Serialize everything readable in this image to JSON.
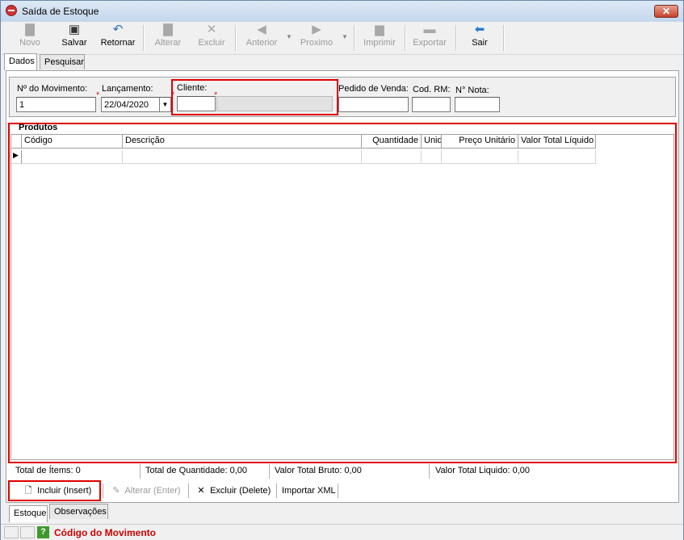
{
  "window": {
    "title": "Saída de Estoque"
  },
  "toolbar": {
    "novo": "Novo",
    "salvar": "Salvar",
    "retornar": "Retornar",
    "alterar": "Alterar",
    "excluir": "Excluir",
    "anterior": "Anterior",
    "proximo": "Proximo",
    "imprimir": "Imprimir",
    "exportar": "Exportar",
    "sair": "Sair"
  },
  "tabs_top": [
    "Dados",
    "Pesquisar"
  ],
  "header": {
    "movimento_label": "Nº do Movimento:",
    "movimento_value": "1",
    "lancamento_label": "Lançamento:",
    "lancamento_value": "22/04/2020",
    "cliente_label": "Cliente:",
    "cliente_code": "",
    "cliente_name": "",
    "pedido_label": "Pedido de Venda:",
    "pedido_value": "",
    "codrm_label": "Cod. RM:",
    "codrm_value": "",
    "nota_label": "N° Nota:",
    "nota_value": "",
    "required_mark": "*"
  },
  "produtos": {
    "title": "Produtos",
    "columns": [
      "Código",
      "Descrição",
      "Quantidade",
      "Unid",
      "Preço Unitário",
      "Valor Total Líquido"
    ]
  },
  "totals": {
    "itens": "Total de Ítems: 0",
    "quantidade": "Total de Quantidade: 0,00",
    "bruto": "Valor Total Bruto: 0,00",
    "liquido": "Valor Total Liquido: 0,00"
  },
  "actions": {
    "incluir": "Incluir (Insert)",
    "alterar": "Alterar (Enter)",
    "excluir": "Excluir (Delete)",
    "importar": "Importar XML"
  },
  "tabs_bottom": [
    "Estoque",
    "Observações"
  ],
  "status": {
    "help": "?",
    "text": "Código do Movimento"
  }
}
